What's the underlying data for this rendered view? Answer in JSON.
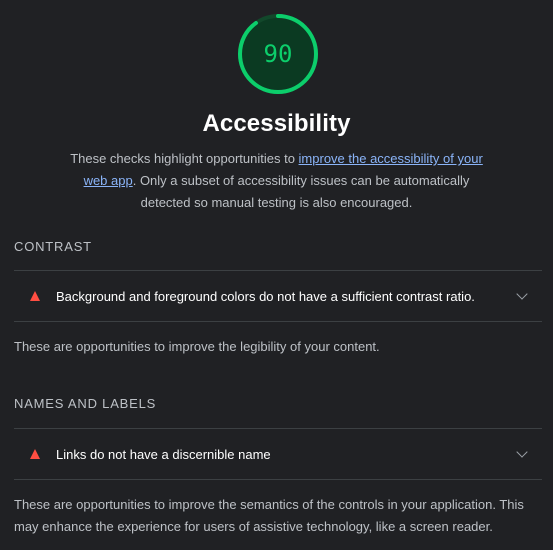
{
  "category": {
    "score": "90",
    "score_fraction": 0.9,
    "title": "Accessibility",
    "description_pre": "These checks highlight opportunities to ",
    "description_link": "improve the accessibility of your web app",
    "description_post": ". Only a subset of accessibility issues can be automatically detected so manual testing is also encouraged.",
    "score_color": "#0cce6b"
  },
  "groups": [
    {
      "title": "CONTRAST",
      "audits": [
        {
          "title": "Background and foreground colors do not have a sufficient contrast ratio.",
          "status": "fail"
        }
      ],
      "description": "These are opportunities to improve the legibility of your content."
    },
    {
      "title": "NAMES AND LABELS",
      "audits": [
        {
          "title": "Links do not have a discernible name",
          "status": "fail"
        }
      ],
      "description": "These are opportunities to improve the semantics of the controls in your application. This may enhance the experience for users of assistive technology, like a screen reader."
    }
  ],
  "icons": {
    "fail": "warning-triangle-icon",
    "expand": "chevron-down-icon"
  },
  "colors": {
    "fail": "#ff4e42",
    "link": "#8ab4f8",
    "background": "#202124"
  }
}
